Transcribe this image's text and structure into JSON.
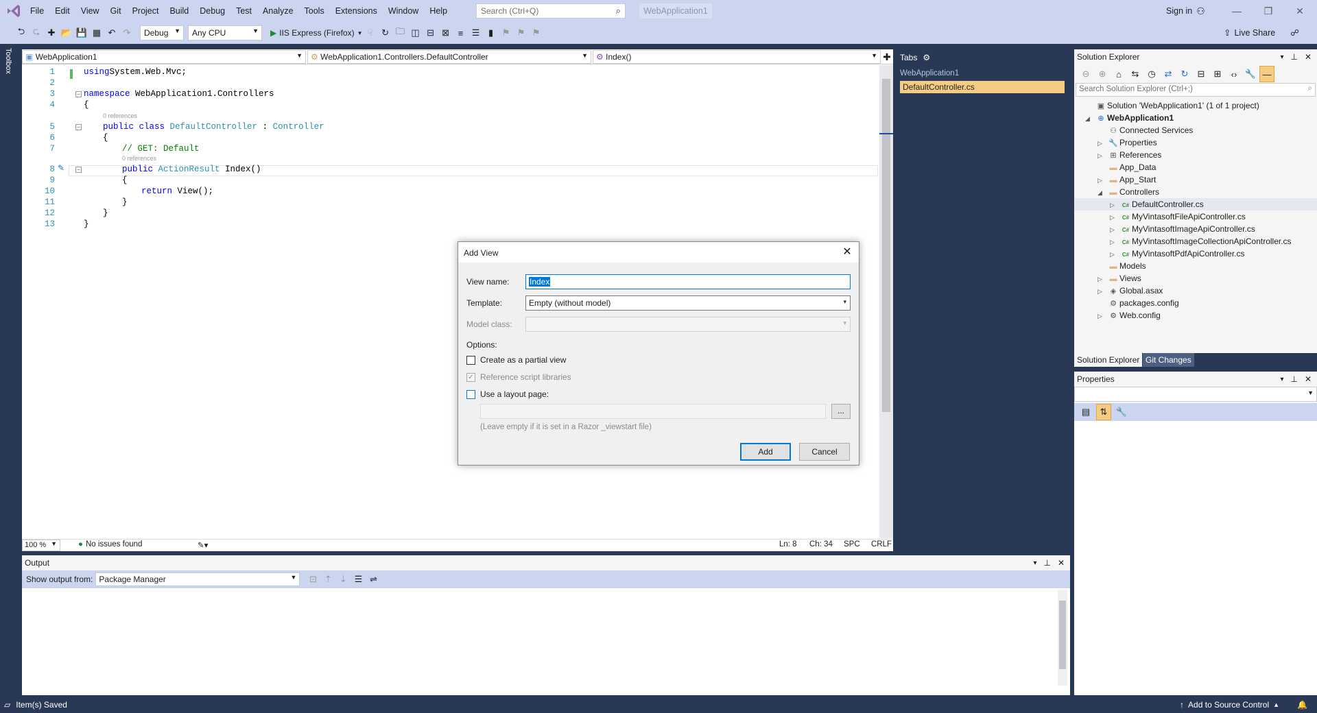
{
  "menu": [
    "File",
    "Edit",
    "View",
    "Git",
    "Project",
    "Build",
    "Debug",
    "Test",
    "Analyze",
    "Tools",
    "Extensions",
    "Window",
    "Help"
  ],
  "search": {
    "placeholder": "Search (Ctrl+Q)"
  },
  "solution_name": "WebApplication1",
  "sign_in": "Sign in",
  "toolbar": {
    "config": "Debug",
    "platform": "Any CPU",
    "run_target": "IIS Express (Firefox)",
    "live_share": "Live Share"
  },
  "left_strip": "Toolbox",
  "editor": {
    "nav": [
      "WebApplication1",
      "WebApplication1.Controllers.DefaultController",
      "Index()"
    ],
    "lines": [
      {
        "n": "1",
        "parts": [
          [
            "kw",
            "using"
          ],
          [
            "",
            "System.Web.Mvc;"
          ]
        ],
        "indent": 0
      },
      {
        "n": "2",
        "parts": [],
        "indent": 0
      },
      {
        "n": "3",
        "parts": [
          [
            "kw",
            "namespace"
          ],
          [
            "",
            " WebApplication1.Controllers"
          ]
        ],
        "indent": 0
      },
      {
        "n": "4",
        "parts": [
          [
            "",
            "{"
          ]
        ],
        "indent": 0
      },
      {
        "n": "5",
        "parts": [
          [
            "kw",
            "public class "
          ],
          [
            "ty",
            "DefaultController"
          ],
          [
            "",
            " : "
          ],
          [
            "ty",
            "Controller"
          ]
        ],
        "indent": 1
      },
      {
        "n": "6",
        "parts": [
          [
            "",
            "{"
          ]
        ],
        "indent": 1
      },
      {
        "n": "7",
        "parts": [
          [
            "cm",
            "// GET: Default"
          ]
        ],
        "indent": 2
      },
      {
        "n": "8",
        "parts": [
          [
            "kw",
            "public "
          ],
          [
            "ty",
            "ActionResult"
          ],
          [
            "",
            " Index()"
          ]
        ],
        "indent": 2
      },
      {
        "n": "9",
        "parts": [
          [
            "",
            "{"
          ]
        ],
        "indent": 2
      },
      {
        "n": "10",
        "parts": [
          [
            "kw",
            "return "
          ],
          [
            "",
            "View();"
          ]
        ],
        "indent": 3
      },
      {
        "n": "11",
        "parts": [
          [
            "",
            "}"
          ]
        ],
        "indent": 2
      },
      {
        "n": "12",
        "parts": [
          [
            "",
            "}"
          ]
        ],
        "indent": 1
      },
      {
        "n": "13",
        "parts": [
          [
            "",
            "}"
          ]
        ],
        "indent": 0
      }
    ],
    "references_label": "0 references",
    "status": {
      "zoom": "100 %",
      "issues": "No issues found",
      "ln": "Ln: 8",
      "ch": "Ch: 34",
      "spc": "SPC",
      "crlf": "CRLF"
    }
  },
  "tabs_pane": {
    "title": "Tabs",
    "group": "WebApplication1",
    "active": "DefaultController.cs"
  },
  "solution_explorer": {
    "title": "Solution Explorer",
    "search_placeholder": "Search Solution Explorer (Ctrl+;)",
    "items": [
      {
        "label": "Solution 'WebApplication1' (1 of 1 project)",
        "level": 0,
        "exp": "",
        "icon": "solution-icon",
        "glyph": "▣",
        "bold": false
      },
      {
        "label": "WebApplication1",
        "level": 0,
        "exp": "◢",
        "icon": "web-project-icon",
        "glyph": "⊕",
        "bold": true
      },
      {
        "label": "Connected Services",
        "level": 1,
        "exp": "",
        "icon": "connected-services-icon",
        "glyph": "⚇",
        "bold": false
      },
      {
        "label": "Properties",
        "level": 1,
        "exp": "▷",
        "icon": "wrench-icon",
        "glyph": "🔧",
        "bold": false
      },
      {
        "label": "References",
        "level": 1,
        "exp": "▷",
        "icon": "references-icon",
        "glyph": "⊞",
        "bold": false
      },
      {
        "label": "App_Data",
        "level": 1,
        "exp": "",
        "icon": "folder-icon",
        "glyph": "▬",
        "bold": false
      },
      {
        "label": "App_Start",
        "level": 1,
        "exp": "▷",
        "icon": "folder-icon",
        "glyph": "▬",
        "bold": false
      },
      {
        "label": "Controllers",
        "level": 1,
        "exp": "◢",
        "icon": "folder-open-icon",
        "glyph": "▬",
        "bold": false
      },
      {
        "label": "DefaultController.cs",
        "level": 2,
        "exp": "▷",
        "icon": "csharp-file-icon",
        "glyph": "C#",
        "bold": false,
        "selected": true
      },
      {
        "label": "MyVintasoftFileApiController.cs",
        "level": 2,
        "exp": "▷",
        "icon": "csharp-file-icon",
        "glyph": "C#",
        "bold": false
      },
      {
        "label": "MyVintasoftImageApiController.cs",
        "level": 2,
        "exp": "▷",
        "icon": "csharp-file-icon",
        "glyph": "C#",
        "bold": false
      },
      {
        "label": "MyVintasoftImageCollectionApiController.cs",
        "level": 2,
        "exp": "▷",
        "icon": "csharp-file-icon",
        "glyph": "C#",
        "bold": false
      },
      {
        "label": "MyVintasoftPdfApiController.cs",
        "level": 2,
        "exp": "▷",
        "icon": "csharp-file-icon",
        "glyph": "C#",
        "bold": false
      },
      {
        "label": "Models",
        "level": 1,
        "exp": "",
        "icon": "folder-icon",
        "glyph": "▬",
        "bold": false
      },
      {
        "label": "Views",
        "level": 1,
        "exp": "▷",
        "icon": "folder-icon",
        "glyph": "▬",
        "bold": false
      },
      {
        "label": "Global.asax",
        "level": 1,
        "exp": "▷",
        "icon": "global-asax-icon",
        "glyph": "◈",
        "bold": false
      },
      {
        "label": "packages.config",
        "level": 1,
        "exp": "",
        "icon": "config-file-icon",
        "glyph": "⚙",
        "bold": false
      },
      {
        "label": "Web.config",
        "level": 1,
        "exp": "▷",
        "icon": "config-file-icon",
        "glyph": "⚙",
        "bold": false
      }
    ],
    "tabs": [
      "Solution Explorer",
      "Git Changes"
    ]
  },
  "properties": {
    "title": "Properties"
  },
  "output": {
    "title": "Output",
    "show_from_label": "Show output from:",
    "source": "Package Manager"
  },
  "statusbar": {
    "left": "Item(s) Saved",
    "right": "Add to Source Control"
  },
  "dialog": {
    "title": "Add View",
    "view_name_label": "View name:",
    "view_name": "Index",
    "template_label": "Template:",
    "template": "Empty (without model)",
    "model_class_label": "Model class:",
    "options_label": "Options:",
    "partial": "Create as a partial view",
    "script_libs": "Reference script libraries",
    "layout": "Use a layout page:",
    "layout_hint": "(Leave empty if it is set in a Razor _viewstart file)",
    "browse": "...",
    "add": "Add",
    "cancel": "Cancel"
  },
  "colors": {
    "accent": "#293955",
    "chrome": "#ccd5f0",
    "highlight": "#f5cc84"
  }
}
